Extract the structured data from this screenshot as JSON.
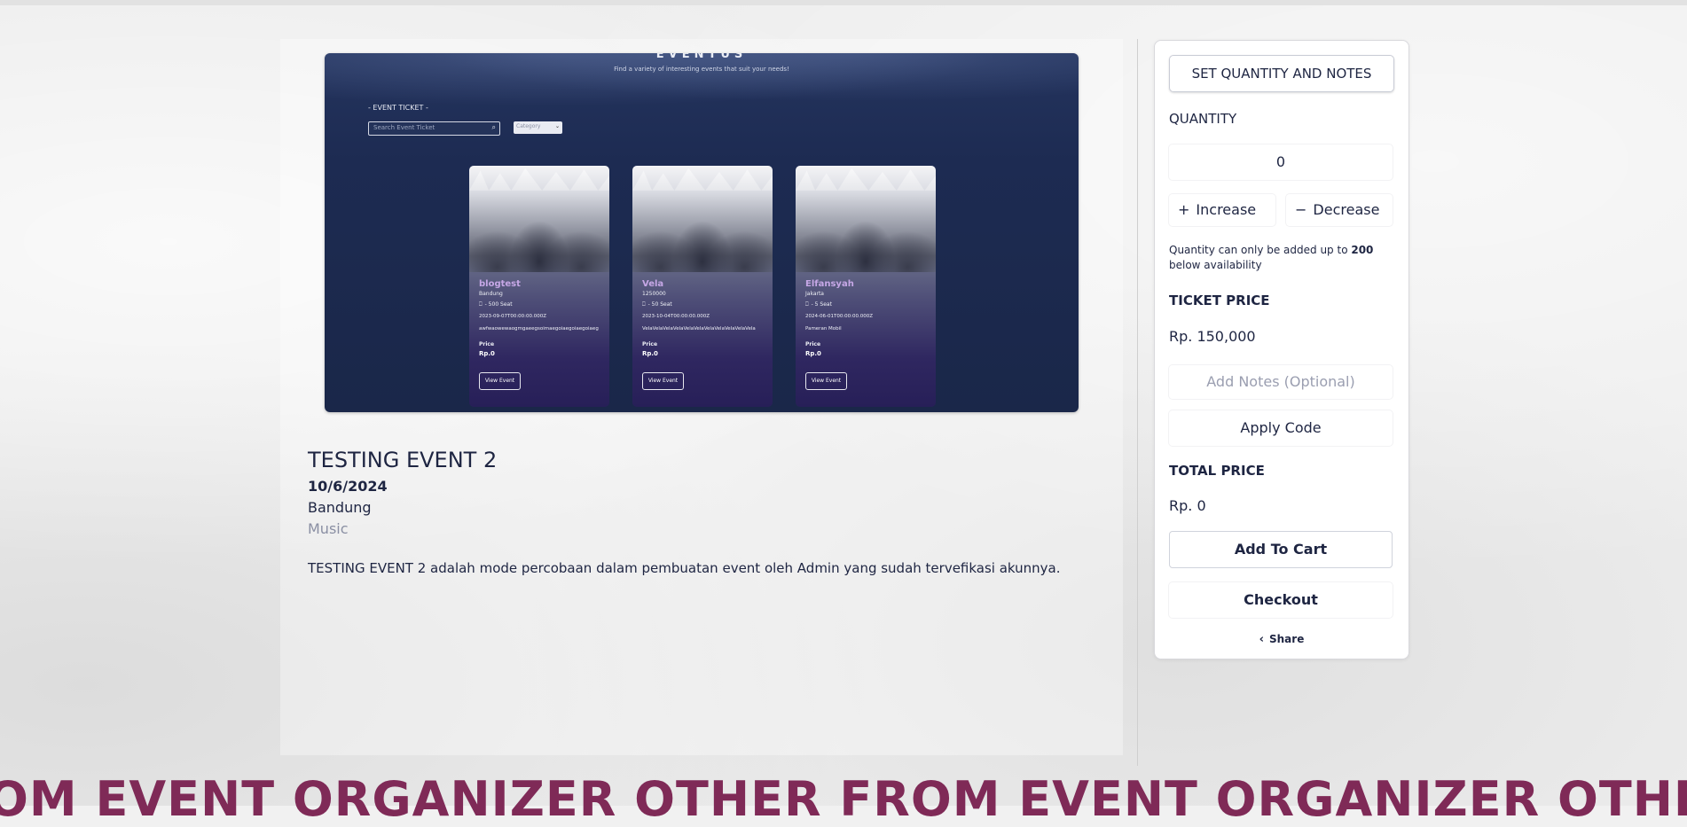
{
  "preview": {
    "logo": "EVENTUS",
    "tagline": "Find a variety of interesting events that suit your needs!",
    "ticket_label": "- EVENT TICKET -",
    "search_placeholder": "Search Event Ticket",
    "category_placeholder": "Category",
    "cards": [
      {
        "name": "blogtest",
        "city": "Bandung",
        "seat": "- 500 Seat",
        "date": "2023-09-07T00:00:00.000Z",
        "desc": "awfwaowewaogmgaeegsoimaegoiaegoiaegoiaeg",
        "price_label": "Price",
        "price": "Rp.0",
        "button": "View Event"
      },
      {
        "name": "Vela",
        "city": "1250000",
        "seat": "- 50 Seat",
        "date": "2023-10-04T00:00:00.000Z",
        "desc": "VelaVelaVelaVelaVelaVelaVelaVelaVelaVelaVela",
        "price_label": "Price",
        "price": "Rp.0",
        "button": "View Event"
      },
      {
        "name": "Elfansyah",
        "city": "Jakarta",
        "seat": "- 5 Seat",
        "date": "2024-06-01T00:00:00.000Z",
        "desc": "Pameran Mobil",
        "price_label": "Price",
        "price": "Rp.0",
        "button": "View Event"
      }
    ]
  },
  "event": {
    "title": "TESTING EVENT 2",
    "date": "10/6/2024",
    "city": "Bandung",
    "category": "Music",
    "description": "TESTING EVENT 2 adalah mode percobaan dalam pembuatan event oleh Admin yang sudah tervefikasi akunnya."
  },
  "sidebar": {
    "header": "SET QUANTITY AND NOTES",
    "quantity_label": "QUANTITY",
    "quantity_value": "0",
    "increase_label": "Increase",
    "decrease_label": "Decrease",
    "note_prefix": "Quantity can only be added up to ",
    "note_max": "200",
    "note_suffix": " below availability",
    "ticket_price_label": "TICKET PRICE",
    "ticket_price": "Rp. 150,000",
    "notes_placeholder": "Add Notes (Optional)",
    "apply_code_label": "Apply Code",
    "total_price_label": "TOTAL PRICE",
    "total_price": "Rp. 0",
    "add_to_cart_label": "Add To Cart",
    "checkout_label": "Checkout",
    "share_label": "Share"
  },
  "marquee": {
    "text": "OM EVENT ORGANIZER OTHER FROM EVENT ORGANIZER OTHER"
  }
}
